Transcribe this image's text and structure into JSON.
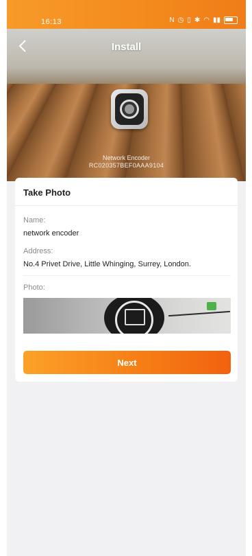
{
  "status_bar": {
    "time": "16:13",
    "icons": [
      "nfc-icon",
      "alarm-icon",
      "vibrate-icon",
      "bluetooth-icon",
      "wifi-icon",
      "signal-icon",
      "battery-icon"
    ]
  },
  "nav": {
    "title": "Install",
    "back_icon": "chevron-left-icon"
  },
  "device": {
    "name": "Network Encoder",
    "id": "RC020357BEF0AAA9104"
  },
  "card": {
    "title": "Take Photo",
    "name_label": "Name:",
    "name_value": "network encoder",
    "address_label": "Address:",
    "address_value": "No.4 Privet Drive, Little Whinging, Surrey, London.",
    "photo_label": "Photo:"
  },
  "next_button": {
    "label": "Next"
  },
  "colors": {
    "accent": "#f58a1c",
    "button_start": "#fba128",
    "button_end": "#f1620f"
  }
}
